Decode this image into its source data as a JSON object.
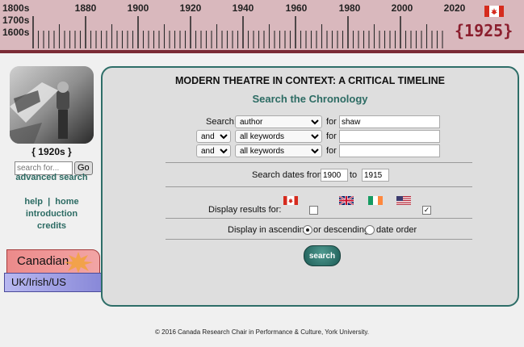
{
  "timeline": {
    "century_labels": [
      "1800s",
      "1700s",
      "1600s"
    ],
    "decades": [
      "1880",
      "1900",
      "1920",
      "1940",
      "1960",
      "1980",
      "2000",
      "2020"
    ],
    "current_year": "{1925}"
  },
  "sidebar": {
    "era_label": "{ 1920s }",
    "search_placeholder": "search for...",
    "go_label": "Go",
    "advanced_search": "advanced search",
    "help": "help",
    "separator": "|",
    "home": "home",
    "introduction": "introduction",
    "credits": "credits"
  },
  "tabs": {
    "canadian": "Canadian",
    "uk_irish_us": "UK/Irish/US"
  },
  "main": {
    "title": "MODERN THEATRE IN CONTEXT: A CRITICAL TIMELINE",
    "subtitle": "Search the Chronology",
    "search_label": "Search:",
    "rows": [
      {
        "operator": "",
        "field": "author",
        "for": "for",
        "value": "shaw"
      },
      {
        "operator": "and",
        "field": "all keywords",
        "for": "for",
        "value": ""
      },
      {
        "operator": "and",
        "field": "all keywords",
        "for": "for",
        "value": ""
      }
    ],
    "dates_label": "Search dates from:",
    "date_from": "1900",
    "to_label": "to",
    "date_to": "1915",
    "display_results_label": "Display results for:",
    "order_label": "Display in ascending",
    "or_descending": "or descending",
    "date_order": "date order",
    "search_button": "search"
  },
  "footer": "© 2016 Canada Research Chair in Performance & Culture, York University.",
  "colors": {
    "accent": "#2c6b63",
    "header": "#d9b8bd",
    "header_line": "#7a2a35",
    "year": "#8b1e2e"
  }
}
